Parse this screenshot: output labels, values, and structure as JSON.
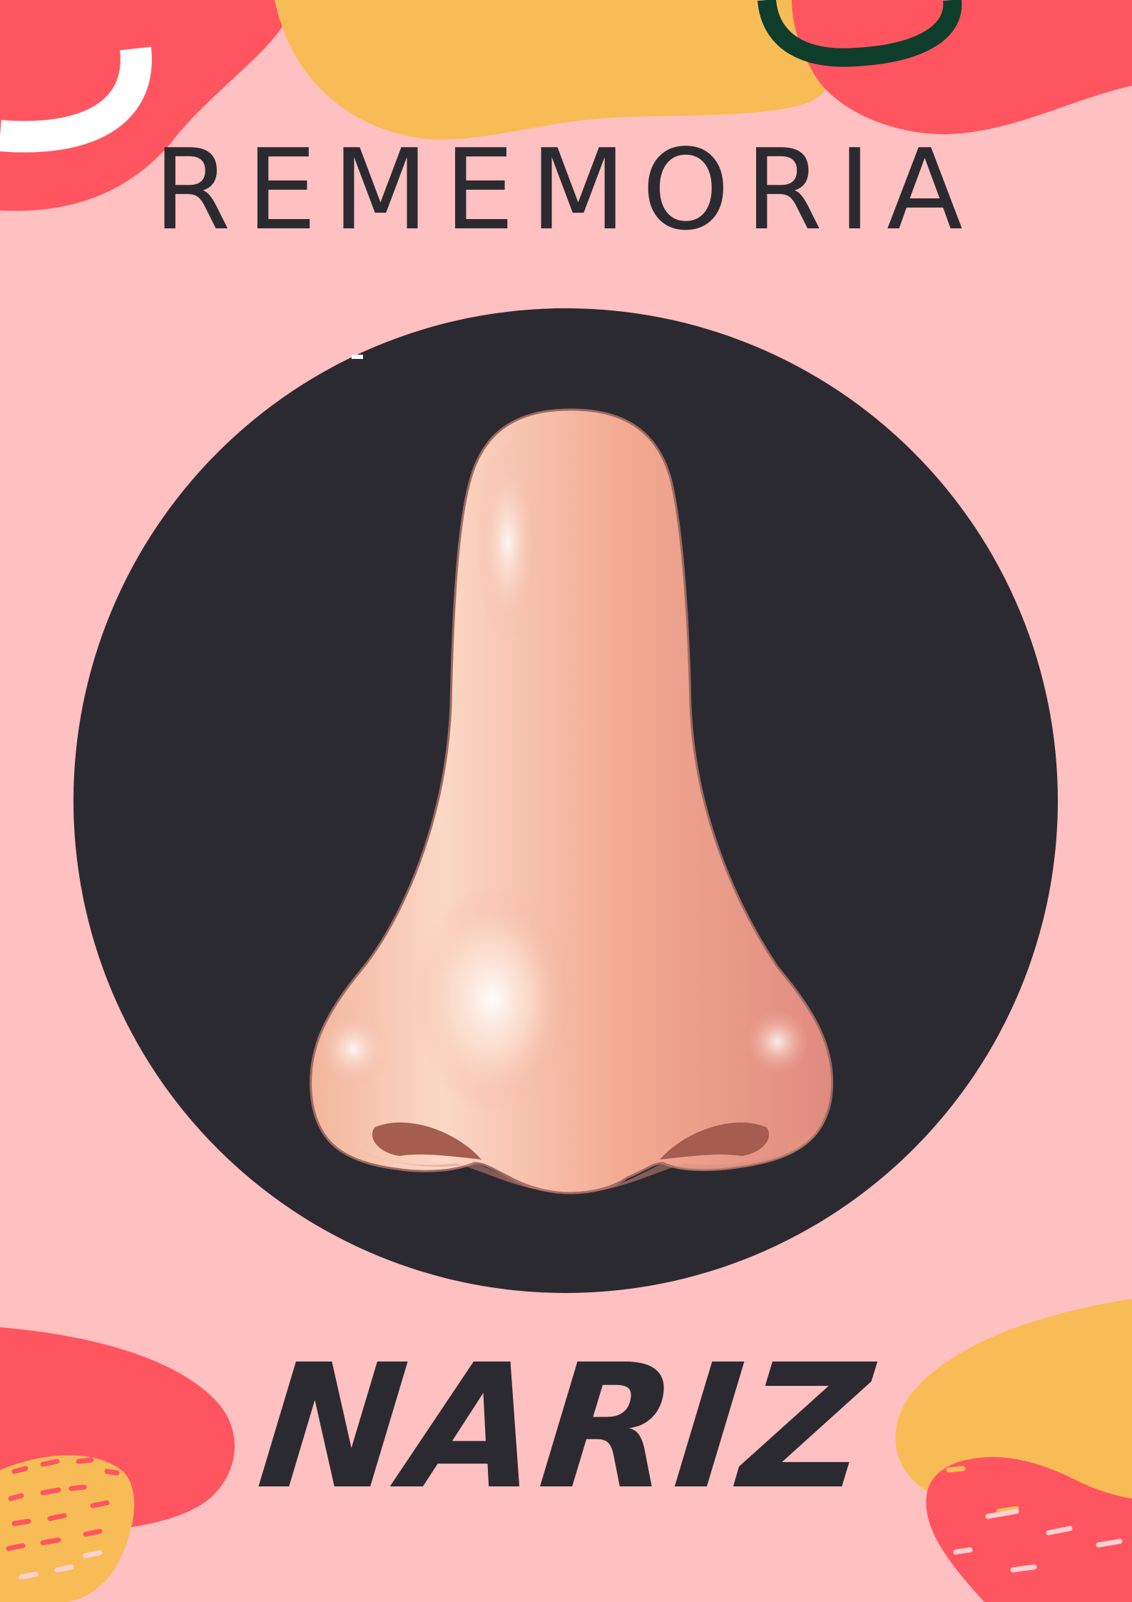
{
  "card": {
    "title": "REMEMORIA",
    "word": "NARIZ",
    "illustration": "nose-illustration"
  },
  "colors": {
    "background": "#ffc0c2",
    "circle": "#2b2a30",
    "text": "#2b2a30",
    "coral": "#ff5560",
    "yellow": "#f8bc57",
    "dark_green": "#0f3d2c",
    "skin": "#f2ad94"
  }
}
